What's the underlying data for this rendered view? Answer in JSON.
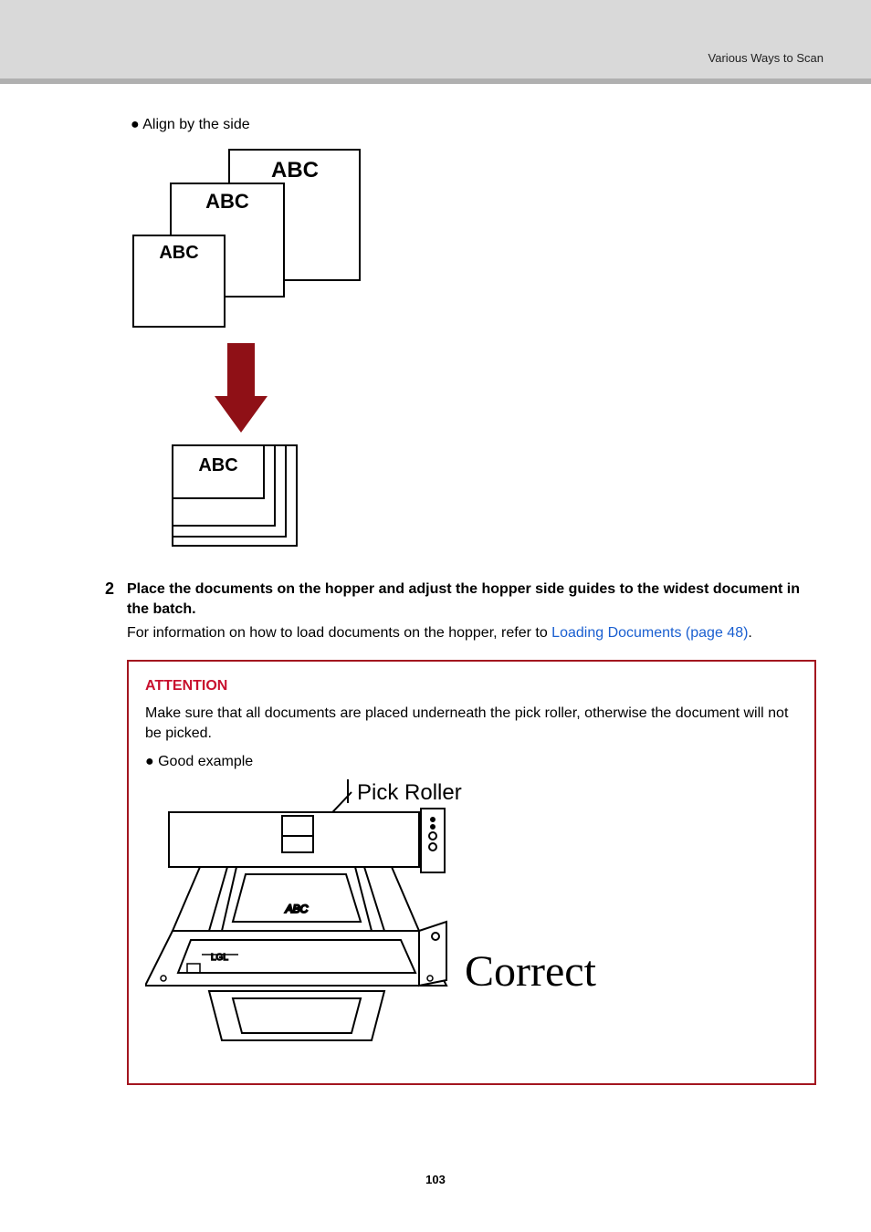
{
  "breadcrumb": "Various Ways to Scan",
  "bullet_align": "● Align by the side",
  "step": {
    "num": "2",
    "title": "Place the documents on the hopper and adjust the hopper side guides to the widest document in the batch.",
    "text_before_link": "For information on how to load documents on the hopper, refer to ",
    "link": "Loading Documents (page 48)",
    "text_after_link": "."
  },
  "attention": {
    "heading": "ATTENTION",
    "body": "Make sure that all documents are placed underneath the pick roller, otherwise the document will not be picked.",
    "good_example": "● Good example"
  },
  "diagram1": {
    "abc": "ABC",
    "pick_roller": "Pick Roller",
    "correct": "Correct"
  },
  "page_number": "103"
}
